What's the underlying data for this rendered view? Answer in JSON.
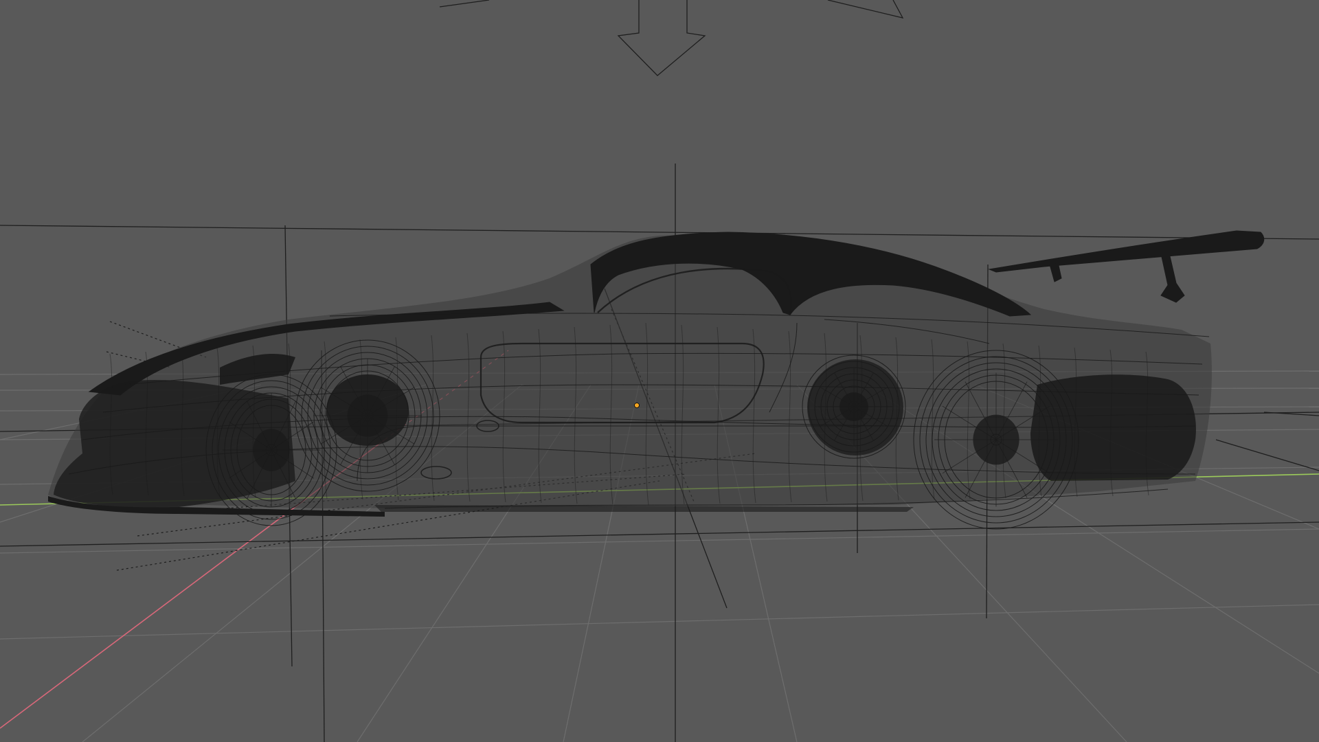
{
  "app": {
    "window": "3D Viewport",
    "mode": "wireframe"
  },
  "viewport": {
    "background_color": "#595959",
    "grid_color": "#6e6e6e",
    "axis_x_color": "#d9687a",
    "axis_y_color": "#9ccb5a",
    "wire_color": "#1a1a1a",
    "origin_color": "#f4a623",
    "icons": {
      "light": "light-arrow-icon",
      "origin": "object-origin-icon",
      "empty": "empty-crosshair-icon"
    }
  },
  "model": {
    "object": "sports-car-wireframe"
  }
}
